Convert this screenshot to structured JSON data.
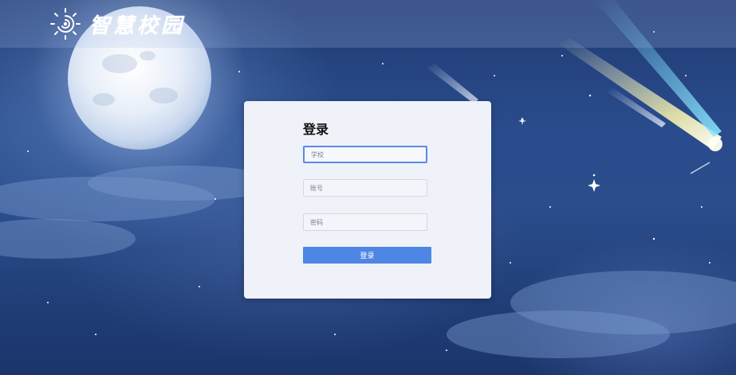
{
  "brand": {
    "title": "智慧校园",
    "logo_icon": "swirl-sun-icon"
  },
  "login": {
    "title": "登录",
    "school_placeholder": "学校",
    "account_placeholder": "账号",
    "password_placeholder": "密码",
    "submit_label": "登录"
  },
  "colors": {
    "accent": "#4e86e4",
    "focus_border": "#5a8ae6",
    "card_bg": "#eff2f8",
    "sky": "#2a4c8c"
  }
}
